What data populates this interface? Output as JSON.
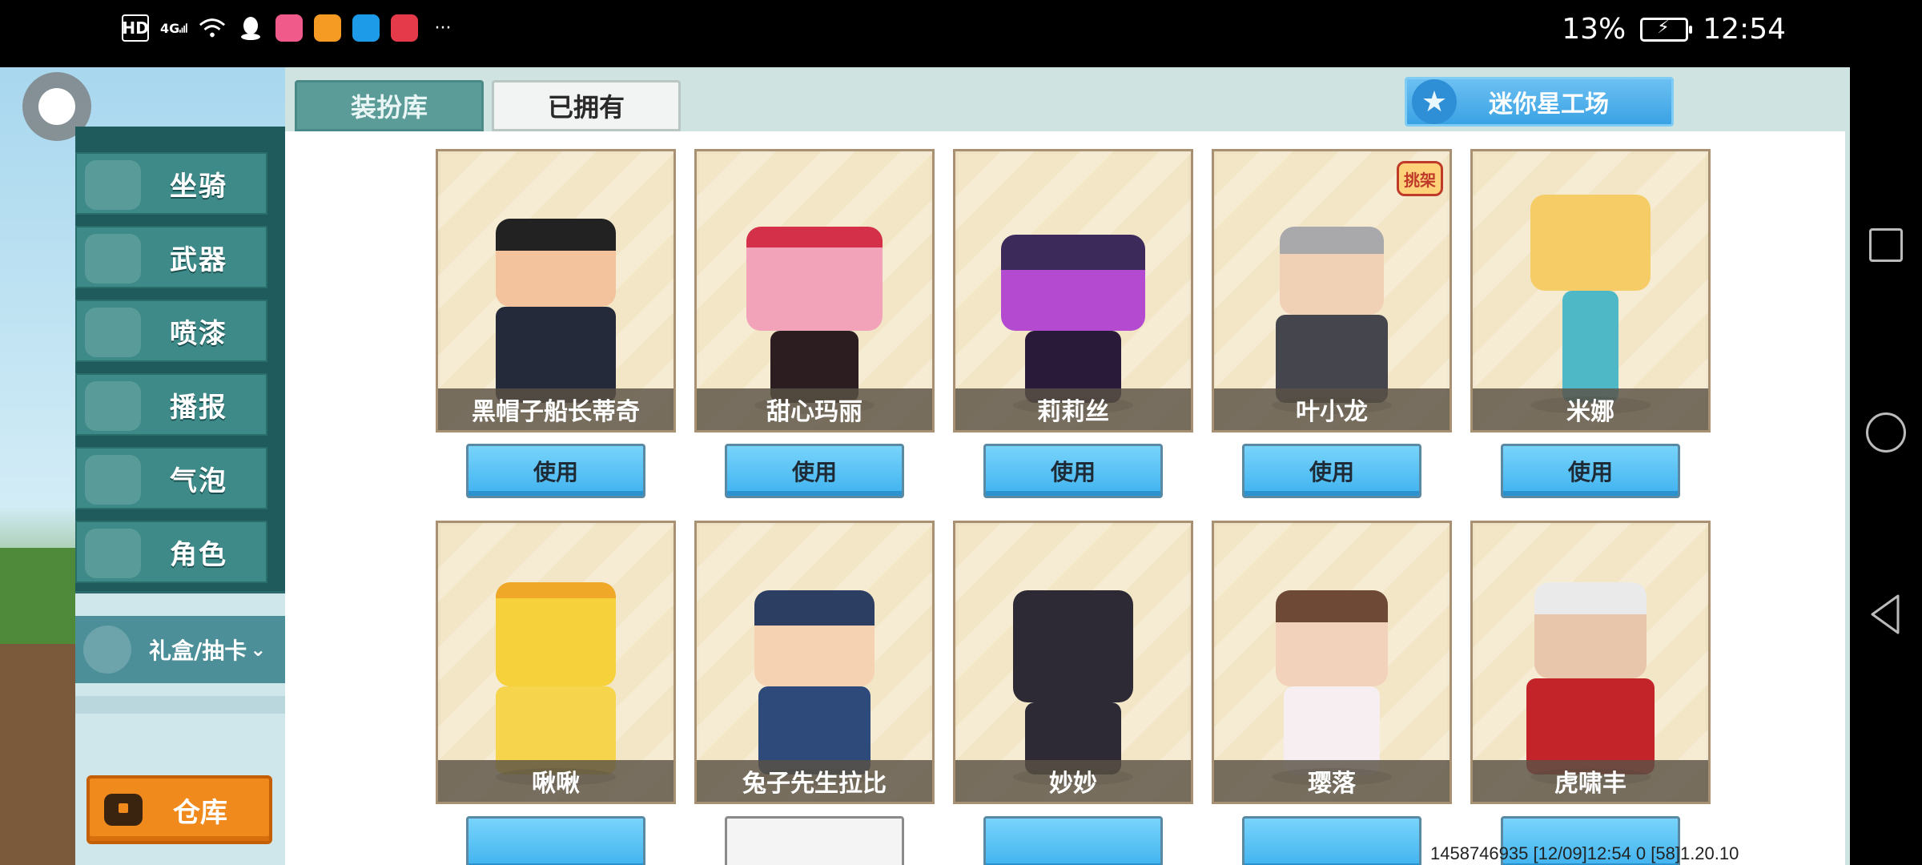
{
  "status_bar": {
    "hd": "HD",
    "network": "4G",
    "battery": "13%",
    "time": "12:54",
    "more": "···"
  },
  "tabs": [
    {
      "label": "装扮库",
      "active": true
    },
    {
      "label": "已拥有",
      "active": false
    }
  ],
  "star_workshop": "迷你星工场",
  "sidebar": {
    "items": [
      {
        "label": "坐骑"
      },
      {
        "label": "武器"
      },
      {
        "label": "喷漆"
      },
      {
        "label": "播报"
      },
      {
        "label": "气泡"
      },
      {
        "label": "角色"
      }
    ],
    "gift": "礼盒/抽卡",
    "warehouse": "仓库"
  },
  "cards_row1": [
    {
      "name": "黑帽子船长蒂奇",
      "button": "使用"
    },
    {
      "name": "甜心玛丽",
      "button": "使用"
    },
    {
      "name": "莉莉丝",
      "button": "使用"
    },
    {
      "name": "叶小龙",
      "button": "使用",
      "badge": "挑架"
    },
    {
      "name": "米娜",
      "button": "使用"
    }
  ],
  "cards_row2": [
    {
      "name": "啾啾"
    },
    {
      "name": "兔子先生拉比"
    },
    {
      "name": "妙妙"
    },
    {
      "name": "璎落"
    },
    {
      "name": "虎啸丰"
    }
  ],
  "footer": "1458746935   [12/09]12:54 0   [58]1.20.10",
  "colors": {
    "sidebar_bg": "#1f5a5c",
    "sidebar_item": "#3d8a88",
    "tab_active": "#5b9c98",
    "use_button": "#3fb2ef",
    "warehouse": "#f08a1c"
  }
}
